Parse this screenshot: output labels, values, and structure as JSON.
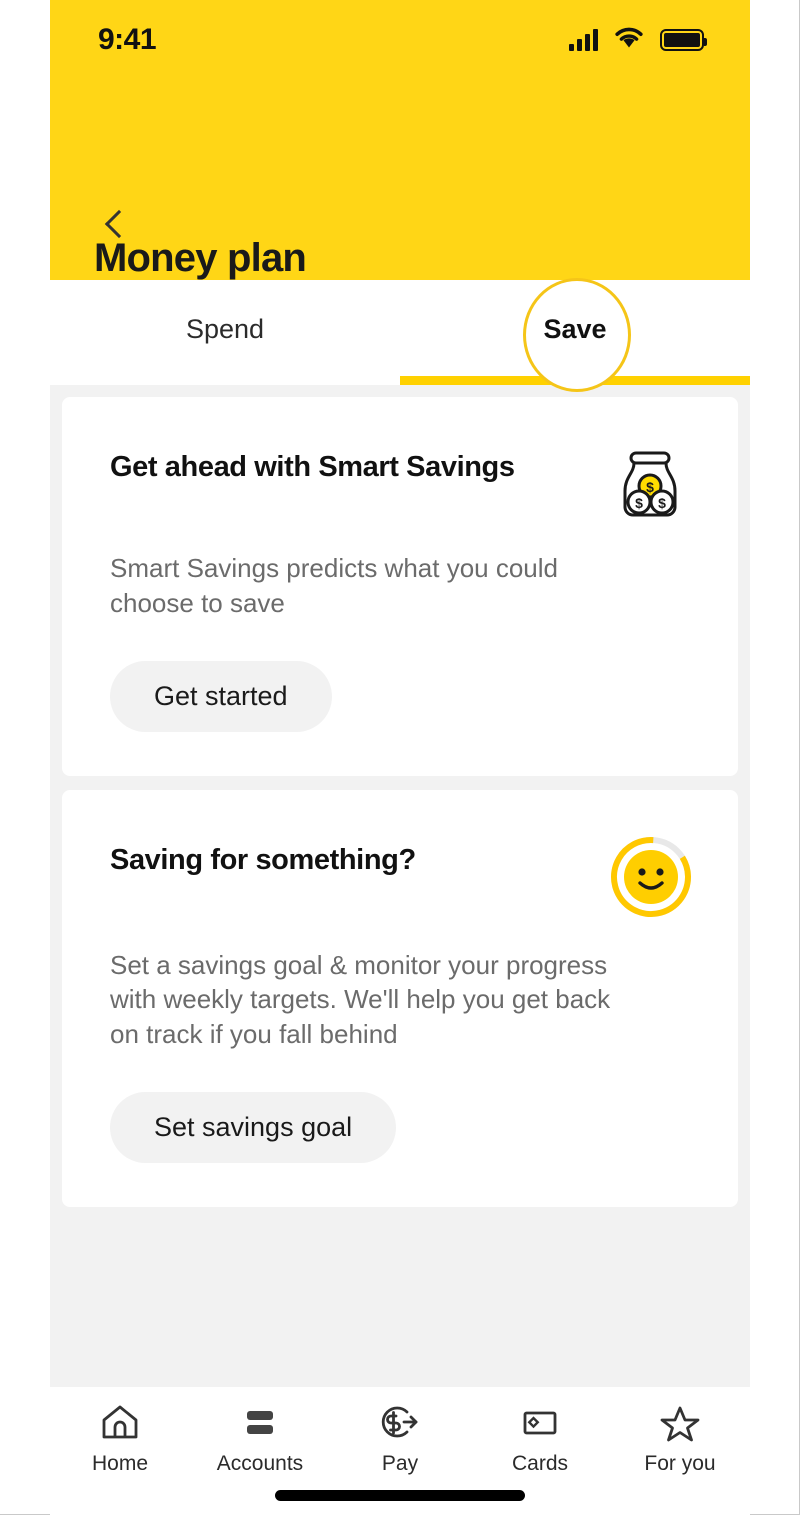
{
  "status_bar": {
    "time": "9:41",
    "signal_icon": "cellular-signal-icon",
    "wifi_icon": "wifi-icon",
    "battery_icon": "battery-full-icon"
  },
  "header": {
    "back_icon": "back-chevron-icon",
    "title": "Money plan",
    "background_color": "#FFD616"
  },
  "tabs": {
    "items": [
      {
        "label": "Spend",
        "active": false
      },
      {
        "label": "Save",
        "active": true
      }
    ],
    "active_underline_color": "#FFD100",
    "highlight_ring_color": "#F5C518"
  },
  "cards": [
    {
      "title": "Get ahead with Smart Savings",
      "body": "Smart Savings predicts what you could choose to save",
      "button_label": "Get started",
      "icon": "savings-jar-icon"
    },
    {
      "title": "Saving for something?",
      "body": "Set a savings goal & monitor your progress with weekly targets. We'll help you get back on track if you fall behind",
      "button_label": "Set savings goal",
      "icon": "smiley-progress-icon"
    }
  ],
  "bottom_nav": {
    "items": [
      {
        "label": "Home",
        "icon": "home-icon"
      },
      {
        "label": "Accounts",
        "icon": "accounts-bars-icon"
      },
      {
        "label": "Pay",
        "icon": "pay-dollar-arrow-icon"
      },
      {
        "label": "Cards",
        "icon": "card-icon"
      },
      {
        "label": "For you",
        "icon": "star-icon"
      }
    ]
  },
  "colors": {
    "brand_yellow": "#FFD616",
    "accent_yellow": "#FFD100",
    "page_background": "#F2F2F2",
    "card_background": "#FFFFFF"
  }
}
